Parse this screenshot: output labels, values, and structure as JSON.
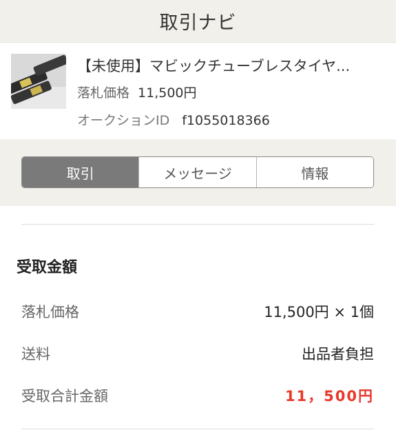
{
  "header": {
    "title": "取引ナビ"
  },
  "item": {
    "thumbnail_alt": "tire-product-photo",
    "title": "【未使用】マビックチューブレスタイヤ...",
    "price_label": "落札価格",
    "price_value": "11,500円",
    "auction_id_label": "オークションID",
    "auction_id_value": "f1055018366"
  },
  "tabs": [
    {
      "label": "取引",
      "active": true
    },
    {
      "label": "メッセージ",
      "active": false
    },
    {
      "label": "情報",
      "active": false
    }
  ],
  "receipt": {
    "title": "受取金額",
    "rows": [
      {
        "label": "落札価格",
        "value": "11,500円 × 1個"
      },
      {
        "label": "送料",
        "value": "出品者負担"
      },
      {
        "label": "受取合計金額",
        "value": "11，500円"
      }
    ]
  },
  "colors": {
    "header_bg": "#f2f0ea",
    "active_tab_bg": "#7a7a7a",
    "total_red": "#e8382a"
  }
}
